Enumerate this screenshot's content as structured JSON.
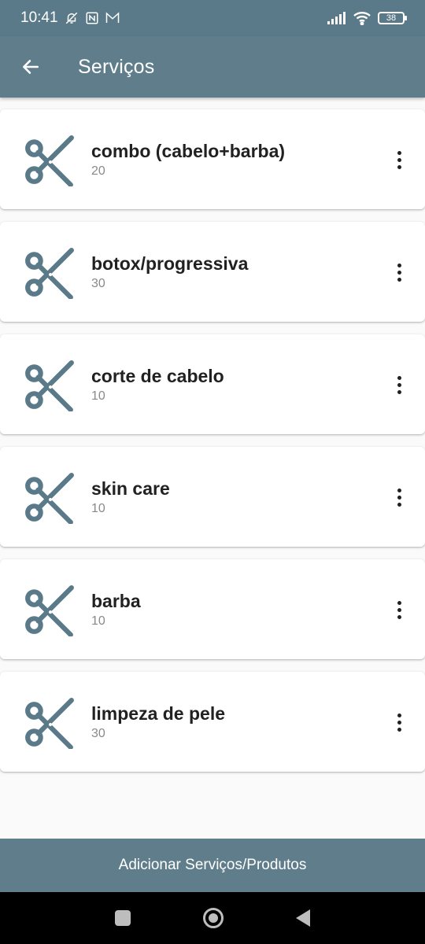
{
  "status_bar": {
    "time": "10:41",
    "battery": "38"
  },
  "app_bar": {
    "title": "Serviços",
    "back_icon": "arrow-back-icon"
  },
  "services": [
    {
      "name": "combo (cabelo+barba)",
      "value": "20",
      "icon": "scissors-icon"
    },
    {
      "name": "botox/progressiva",
      "value": "30",
      "icon": "scissors-icon"
    },
    {
      "name": "corte de cabelo",
      "value": "10",
      "icon": "scissors-icon"
    },
    {
      "name": "skin care",
      "value": "10",
      "icon": "scissors-icon"
    },
    {
      "name": "barba",
      "value": "10",
      "icon": "scissors-icon"
    },
    {
      "name": "limpeza de pele",
      "value": "30",
      "icon": "scissors-icon"
    }
  ],
  "footer": {
    "add_label": "Adicionar Serviços/Produtos"
  },
  "colors": {
    "primary": "#607d8b",
    "icon": "#5b7a89",
    "text": "#212121",
    "secondary_text": "#8a8a8a"
  }
}
